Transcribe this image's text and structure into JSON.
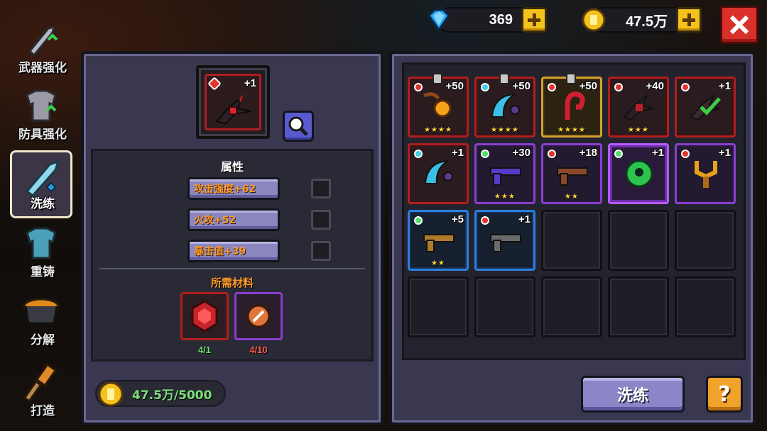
{
  "currency": {
    "gems": "369",
    "gold": "47.5万"
  },
  "sidebar": {
    "items": [
      {
        "label": "武器强化",
        "icon": "sword-upgrade-icon"
      },
      {
        "label": "防具强化",
        "icon": "armor-upgrade-icon"
      },
      {
        "label": "洗练",
        "icon": "reforge-sword-icon",
        "active": true
      },
      {
        "label": "重铸",
        "icon": "recast-armor-icon"
      },
      {
        "label": "分解",
        "icon": "cauldron-icon"
      },
      {
        "label": "打造",
        "icon": "forge-hammer-icon"
      }
    ]
  },
  "selected_item": {
    "level": "+1",
    "icon": "dark-claw-weapon-icon"
  },
  "attributes": {
    "title": "属性",
    "rows": [
      "攻击强度+62",
      "火攻+52",
      "暴击值+39"
    ]
  },
  "materials": {
    "title": "所需材料",
    "items": [
      {
        "icon": "red-crystal-icon",
        "count": "4/1",
        "count_color": "#6fdc6f"
      },
      {
        "icon": "scroll-icon",
        "count": "4/10",
        "count_color": "#ff5a4a"
      }
    ]
  },
  "cost": {
    "label": "47.5万/5000"
  },
  "inventory": [
    {
      "level": "+50",
      "stars": "★★★★",
      "rarity": "red",
      "gem": "#e0342c",
      "locked": true,
      "icon": "fire-lantern-staff-icon"
    },
    {
      "level": "+50",
      "stars": "★★★★",
      "rarity": "red",
      "gem": "#39d0e8",
      "locked": true,
      "icon": "ice-scythe-icon"
    },
    {
      "level": "+50",
      "stars": "★★★★",
      "rarity": "gold",
      "gem": "#e0342c",
      "locked": true,
      "icon": "red-hook-icon"
    },
    {
      "level": "+40",
      "stars": "★★★",
      "rarity": "red",
      "gem": "#e0342c",
      "locked": false,
      "icon": "dark-claw-icon"
    },
    {
      "level": "+1",
      "stars": "",
      "rarity": "red",
      "gem": "#e0342c",
      "locked": false,
      "icon": "equipped-claw-icon"
    },
    {
      "level": "+1",
      "stars": "",
      "rarity": "red",
      "gem": "#39d0e8",
      "locked": false,
      "icon": "ice-scythe-icon"
    },
    {
      "level": "+30",
      "stars": "★★★",
      "rarity": "purple",
      "gem": "#4ee06a",
      "locked": false,
      "icon": "void-rifle-icon"
    },
    {
      "level": "+18",
      "stars": "★★",
      "rarity": "purple",
      "gem": "#e0342c",
      "locked": false,
      "icon": "crossbow-icon"
    },
    {
      "level": "+1",
      "stars": "",
      "rarity": "purple-bright",
      "gem": "#4ee06a",
      "locked": false,
      "icon": "green-eye-icon"
    },
    {
      "level": "+1",
      "stars": "",
      "rarity": "purple",
      "gem": "#e0342c",
      "locked": false,
      "icon": "slingshot-icon"
    },
    {
      "level": "+5",
      "stars": "★★",
      "rarity": "blue",
      "gem": "#4ee06a",
      "locked": false,
      "icon": "shotgun-icon"
    },
    {
      "level": "+1",
      "stars": "",
      "rarity": "blue",
      "gem": "#e0342c",
      "locked": false,
      "icon": "pistol-icon"
    }
  ],
  "actions": {
    "reforge_label": "洗练",
    "help_label": "?"
  }
}
